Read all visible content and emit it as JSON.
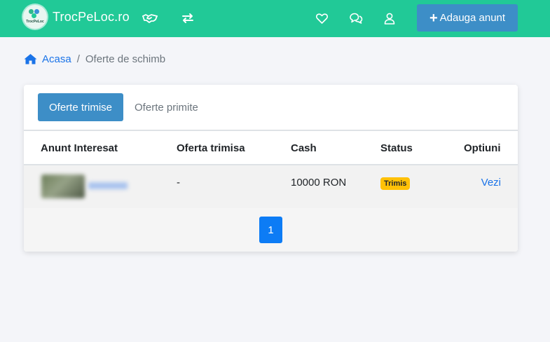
{
  "header": {
    "logo_text": "TrocPeLoc",
    "brand": "TrocPeLoc.ro",
    "add_button_label": "Adauga anunt",
    "icons": [
      "handshake-icon",
      "exchange-arrows-icon",
      "heart-icon",
      "chat-icon",
      "user-icon"
    ]
  },
  "breadcrumb": {
    "home_label": "Acasa",
    "separator": "/",
    "current": "Oferte de schimb"
  },
  "tabs": [
    {
      "label": "Oferte trimise",
      "active": true
    },
    {
      "label": "Oferte primite",
      "active": false
    }
  ],
  "table": {
    "columns": [
      "Anunt Interesat",
      "Oferta trimisa",
      "Cash",
      "Status",
      "Optiuni"
    ],
    "rows": [
      {
        "offer_sent": "-",
        "cash": "10000 RON",
        "status": "Trimis",
        "option_label": "Vezi"
      }
    ]
  },
  "pagination": {
    "current_page": "1"
  },
  "colors": {
    "navbar": "#21c997",
    "primary_button": "#3d8ec7",
    "link": "#1a73e8",
    "status_badge": "#ffc107",
    "page_active": "#0d7cf5",
    "background": "#f4f5f9"
  }
}
